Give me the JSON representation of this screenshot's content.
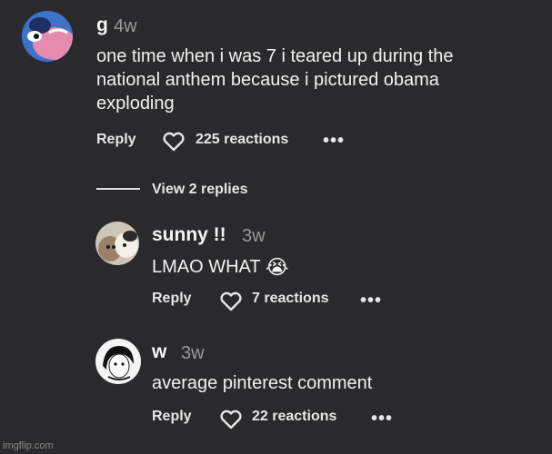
{
  "comments": [
    {
      "user": "g",
      "time": "4w",
      "lines": [
        "one time when i was 7 i teared up during the",
        "national anthem because i pictured obama",
        "exploding"
      ],
      "reply_label": "Reply",
      "reactions": "225 reactions",
      "more_label": "•••"
    },
    {
      "user": "sunny !!",
      "time": "3w",
      "text": "LMAO WHAT",
      "emoji": "😭",
      "reply_label": "Reply",
      "reactions": "7 reactions",
      "more_label": "•••"
    },
    {
      "user": "w",
      "time": "3w",
      "text": "average pinterest comment",
      "reply_label": "Reply",
      "reactions": "22 reactions",
      "more_label": "•••"
    }
  ],
  "view_replies_label": "View 2 replies",
  "watermark": "imgflip.com",
  "colors": {
    "background": "#2a2a2c",
    "text": "#f2f2f2",
    "muted": "#9a9a9a"
  },
  "icons": [
    "heart-icon",
    "more-icon"
  ]
}
